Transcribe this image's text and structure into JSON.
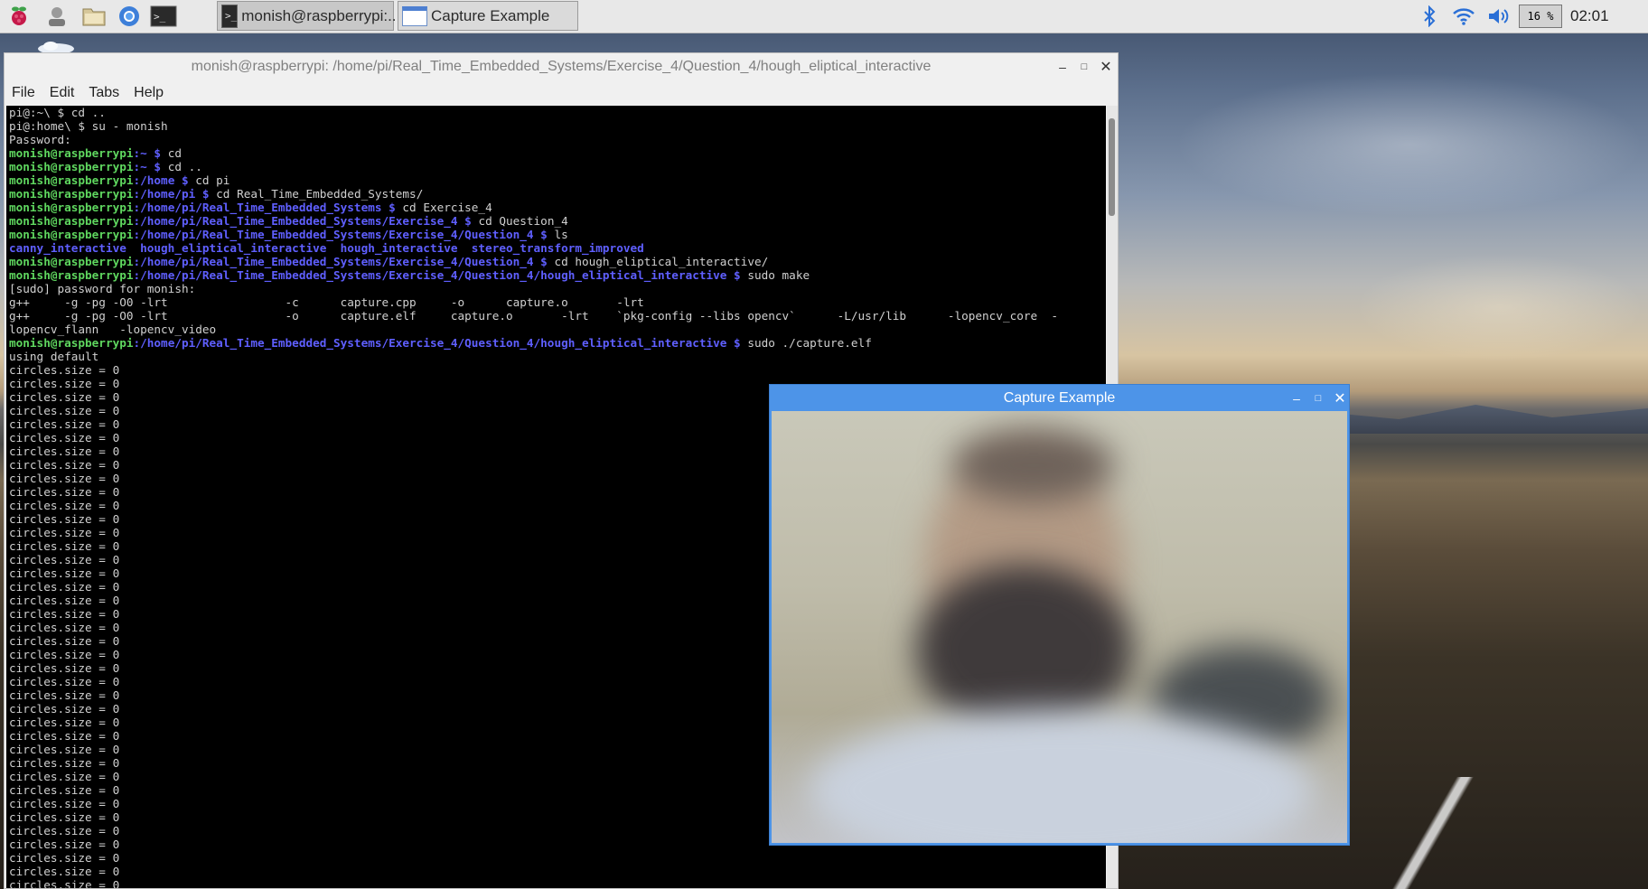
{
  "taskbar": {
    "launchers": [
      "raspberry-menu",
      "user-icon",
      "file-manager",
      "browser",
      "terminal"
    ],
    "tasks": [
      {
        "label": "monish@raspberrypi:...",
        "icon": "terminal"
      },
      {
        "label": "Capture Example",
        "icon": "window"
      }
    ],
    "cpu": "16 %",
    "clock": "02:01"
  },
  "terminal": {
    "title": "monish@raspberrypi: /home/pi/Real_Time_Embedded_Systems/Exercise_4/Question_4/hough_eliptical_interactive",
    "menu": [
      "File",
      "Edit",
      "Tabs",
      "Help"
    ],
    "lines": [
      {
        "segments": [
          {
            "t": "pi@:~\\ $ cd ..",
            "c": ""
          }
        ]
      },
      {
        "segments": [
          {
            "t": "pi@:home\\ $ su - monish",
            "c": ""
          }
        ]
      },
      {
        "segments": [
          {
            "t": "Password:",
            "c": ""
          }
        ]
      },
      {
        "segments": [
          {
            "t": "monish@raspberrypi",
            "c": "u"
          },
          {
            "t": ":~ $ ",
            "c": "p"
          },
          {
            "t": "cd",
            "c": ""
          }
        ]
      },
      {
        "segments": [
          {
            "t": "monish@raspberrypi",
            "c": "u"
          },
          {
            "t": ":~ $ ",
            "c": "p"
          },
          {
            "t": "cd ..",
            "c": ""
          }
        ]
      },
      {
        "segments": [
          {
            "t": "monish@raspberrypi",
            "c": "u"
          },
          {
            "t": ":/home $ ",
            "c": "p"
          },
          {
            "t": "cd pi",
            "c": ""
          }
        ]
      },
      {
        "segments": [
          {
            "t": "monish@raspberrypi",
            "c": "u"
          },
          {
            "t": ":/home/pi $ ",
            "c": "p"
          },
          {
            "t": "cd Real_Time_Embedded_Systems/",
            "c": ""
          }
        ]
      },
      {
        "segments": [
          {
            "t": "monish@raspberrypi",
            "c": "u"
          },
          {
            "t": ":/home/pi/Real_Time_Embedded_Systems $ ",
            "c": "p"
          },
          {
            "t": "cd Exercise_4",
            "c": ""
          }
        ]
      },
      {
        "segments": [
          {
            "t": "monish@raspberrypi",
            "c": "u"
          },
          {
            "t": ":/home/pi/Real_Time_Embedded_Systems/Exercise_4 $ ",
            "c": "p"
          },
          {
            "t": "cd Question_4",
            "c": ""
          }
        ]
      },
      {
        "segments": [
          {
            "t": "monish@raspberrypi",
            "c": "u"
          },
          {
            "t": ":/home/pi/Real_Time_Embedded_Systems/Exercise_4/Question_4 $ ",
            "c": "p"
          },
          {
            "t": "ls",
            "c": ""
          }
        ]
      },
      {
        "segments": [
          {
            "t": "canny_interactive  hough_eliptical_interactive  hough_interactive  stereo_transform_improved",
            "c": "dir"
          }
        ]
      },
      {
        "segments": [
          {
            "t": "monish@raspberrypi",
            "c": "u"
          },
          {
            "t": ":/home/pi/Real_Time_Embedded_Systems/Exercise_4/Question_4 $ ",
            "c": "p"
          },
          {
            "t": "cd hough_eliptical_interactive/",
            "c": ""
          }
        ]
      },
      {
        "segments": [
          {
            "t": "monish@raspberrypi",
            "c": "u"
          },
          {
            "t": ":/home/pi/Real_Time_Embedded_Systems/Exercise_4/Question_4/hough_eliptical_interactive $ ",
            "c": "p"
          },
          {
            "t": "sudo make",
            "c": ""
          }
        ]
      },
      {
        "segments": [
          {
            "t": "[sudo] password for monish:",
            "c": ""
          }
        ]
      },
      {
        "segments": [
          {
            "t": "g++     -g -pg -O0 -lrt                 -c      capture.cpp     -o      capture.o       -lrt",
            "c": ""
          }
        ]
      },
      {
        "segments": [
          {
            "t": "g++     -g -pg -O0 -lrt                 -o      capture.elf     capture.o       -lrt    `pkg-config --libs opencv`      -L/usr/lib      -lopencv_core  -",
            "c": ""
          }
        ]
      },
      {
        "segments": [
          {
            "t": "lopencv_flann   -lopencv_video",
            "c": ""
          }
        ]
      },
      {
        "segments": [
          {
            "t": "monish@raspberrypi",
            "c": "u"
          },
          {
            "t": ":/home/pi/Real_Time_Embedded_Systems/Exercise_4/Question_4/hough_eliptical_interactive $ ",
            "c": "p"
          },
          {
            "t": "sudo ./capture.elf",
            "c": ""
          }
        ]
      },
      {
        "segments": [
          {
            "t": "using default",
            "c": ""
          }
        ]
      }
    ],
    "repeat_line": "circles.size = 0",
    "repeat_count": 40
  },
  "capture": {
    "title": "Capture Example"
  },
  "colors": {
    "user": "#5fd75f",
    "path": "#5f5fff",
    "capture_titlebar": "#4d94e8"
  }
}
